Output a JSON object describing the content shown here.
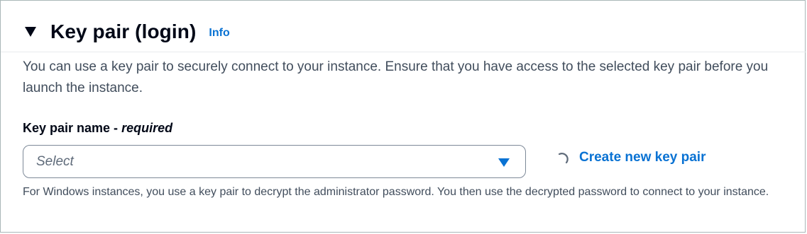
{
  "section": {
    "title": "Key pair (login)",
    "info_label": "Info",
    "description": "You can use a key pair to securely connect to your instance. Ensure that you have access to the selected key pair before you launch the instance."
  },
  "key_pair_field": {
    "label": "Key pair name - ",
    "required_label": "required",
    "placeholder": "Select",
    "create_link": "Create new key pair",
    "constraint_text": "For Windows instances, you use a key pair to decrypt the administrator password. You then use the decrypted password to connect to your instance."
  },
  "icons": {
    "expand": "caret-down-filled-icon",
    "dropdown": "caret-down-filled-icon",
    "loading": "spinner-icon"
  },
  "colors": {
    "link": "#0972d3",
    "text": "#000716",
    "secondary_text": "#414d5c",
    "border": "#aab7b8"
  }
}
